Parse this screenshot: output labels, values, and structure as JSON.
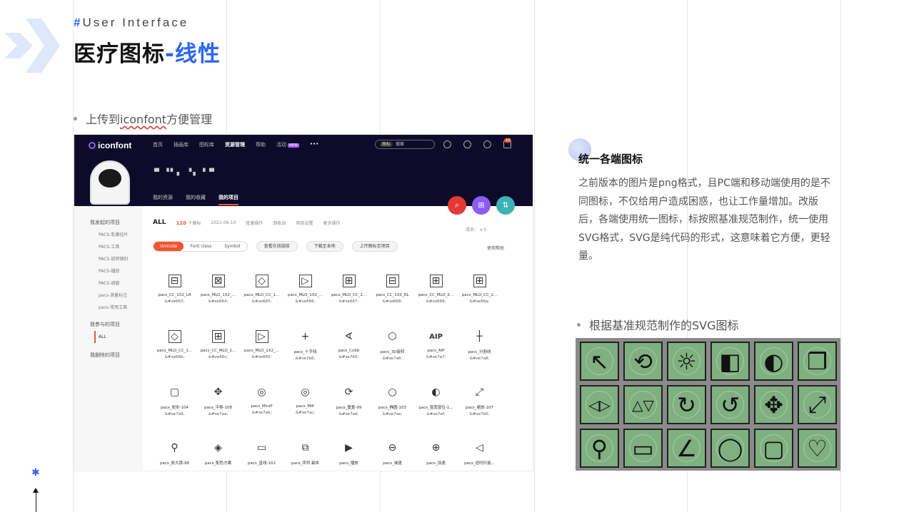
{
  "header": {
    "tag_hash": "#",
    "tag_text": "User Interface",
    "title_main": "医疗图标",
    "title_highlight": "-线性"
  },
  "bullets": {
    "upload_prefix": "上传到",
    "upload_link": "iconfont",
    "upload_suffix": "方便管理",
    "svg_standard": "根据基准规范制作的SVG图标"
  },
  "right": {
    "title": "统一各端图标",
    "paragraph": "之前版本的图片是png格式，且PC端和移动端使用的是不同图标，不仅给用户造成困惑，也让工作量增加。改版后，各端使用统一图标，标按照基准规范制作，统一使用SVG格式，SVG是纯代码的形式，这意味着它方便，更轻量。"
  },
  "screenshot": {
    "logo": "iconfont",
    "nav": [
      "首页",
      "插画库",
      "图标库",
      "资源管理",
      "帮助",
      "活动"
    ],
    "nav_new": "NEW",
    "nav_more": "•••",
    "search_select": "图标",
    "search_placeholder": "搜索",
    "badge": "15",
    "username": "▀ ▝▘▖ ▝▖ ▘▀",
    "subnav": [
      "我的资源",
      "我的收藏",
      "我的项目"
    ],
    "fab": [
      "⌕",
      "⊞",
      "⇅"
    ],
    "sidebar": {
      "started_title": "我发起的项目",
      "started_items": [
        "PACS-乳腺挂片",
        "PACS-工具",
        "PACS-放转镜封",
        "PACS-播放",
        "PACS-调窗",
        "pacs-测量标注",
        "pacs-常用工具"
      ],
      "joined_title": "我参与的项目",
      "joined_items": [
        "ALL"
      ],
      "deleted_title": "我删除的项目"
    },
    "all_label": "ALL",
    "count": "110",
    "count_unit": "个图标",
    "date": "2021-06-10",
    "actions": [
      "批量操作",
      "回收站",
      "项目设置",
      "更多操作"
    ],
    "members": "成员：",
    "members_count": "x 5",
    "tabs": [
      "Unicode",
      "Font class",
      "Symbol"
    ],
    "btn_online": "查看在线链接",
    "btn_download": "下载至本地",
    "btn_upload": "上传图标至项目",
    "help": "使用帮助",
    "icons": [
      {
        "g": "⊟",
        "b": true,
        "name": "pacs_CC_1X2_LR",
        "code": "&#xe663;"
      },
      {
        "g": "⊠",
        "b": true,
        "name": "pacs_MLO_1X2_...",
        "code": "&#xe664;"
      },
      {
        "g": "◇",
        "b": true,
        "name": "pacs_MLO_CC_1...",
        "code": "&#xe665;"
      },
      {
        "g": "▷",
        "b": true,
        "name": "pacs_MLO_1X2_...",
        "code": "&#xe666;"
      },
      {
        "g": "⊞",
        "b": true,
        "name": "pacs_MLO_CC_2...",
        "code": "&#xe667;"
      },
      {
        "g": "⊟",
        "b": true,
        "name": "pacs_CC_1X2_RL",
        "code": "&#xe668;"
      },
      {
        "g": "⊞",
        "b": true,
        "name": "pacs_CC_MLO_2...",
        "code": "&#xe669;"
      },
      {
        "g": "⊞",
        "b": true,
        "name": "pacs_MLO_CC_2...",
        "code": "&#xe66a;"
      },
      {
        "g": "◇",
        "b": true,
        "name": "pacs_MLO_CC_1...",
        "code": "&#xe66b;"
      },
      {
        "g": "⊞",
        "b": true,
        "name": "pacs_CC_MLO_2...",
        "code": "&#xe66c;"
      },
      {
        "g": "▷",
        "b": true,
        "name": "pacs_MLO_1X2_...",
        "code": "&#xe660;"
      },
      {
        "g": "+",
        "b": false,
        "name": "pacs_十字线",
        "code": "&#xe7b6;"
      },
      {
        "g": "∢",
        "b": false,
        "name": "pacs_Cobb",
        "code": "&#xe7b5;"
      },
      {
        "g": "⬡",
        "b": false,
        "name": "pacs_3D旋转",
        "code": "&#xe7a6;"
      },
      {
        "g": "AIP",
        "b": false,
        "name": "pacs_AIP",
        "code": "&#xe7a7;"
      },
      {
        "g": "┼",
        "b": false,
        "name": "pacs_分割线",
        "code": "&#xe7a8;"
      },
      {
        "g": "▢",
        "b": false,
        "name": "pacs_矩形-104",
        "code": "&#xe7a9;"
      },
      {
        "g": "✥",
        "b": false,
        "name": "pacs_平移-108",
        "code": "&#xe7aa;"
      },
      {
        "g": "◎",
        "b": false,
        "name": "pacs_MinIP",
        "code": "&#xe7ab;"
      },
      {
        "g": "◎",
        "b": false,
        "name": "pacs_MIP",
        "code": "&#xe7ac;"
      },
      {
        "g": "⟳",
        "b": false,
        "name": "pacs_重置-99",
        "code": "&#xe7ad;"
      },
      {
        "g": "○",
        "b": false,
        "name": "pacs_椭圆-103",
        "code": "&#xe7ae;"
      },
      {
        "g": "◐",
        "b": false,
        "name": "pacs_窗宽窗位-1...",
        "code": "&#xe7af;"
      },
      {
        "g": "⤢",
        "b": false,
        "name": "pacs_缩放-107",
        "code": "&#xe7b0;"
      },
      {
        "g": "⚲",
        "b": false,
        "name": "pacs_放大镜-98",
        "code": ""
      },
      {
        "g": "◈",
        "b": false,
        "name": "pacs_配色方案",
        "code": ""
      },
      {
        "g": "▭",
        "b": false,
        "name": "pacs_直线-102",
        "code": ""
      },
      {
        "g": "⧉",
        "b": false,
        "name": "pacs_序列 副本",
        "code": ""
      },
      {
        "g": "▶",
        "b": false,
        "name": "pacs_播放",
        "code": ""
      },
      {
        "g": "⊖",
        "b": false,
        "name": "pacs_减速",
        "code": ""
      },
      {
        "g": "⊕",
        "b": false,
        "name": "pacs_加速",
        "code": ""
      },
      {
        "g": "◁",
        "b": false,
        "name": "pacs_逆时针旋...",
        "code": ""
      }
    ]
  },
  "svg_tiles": [
    "cursor-icon",
    "rotate-icon",
    "contrast-sun-icon",
    "window-level-icon",
    "half-contrast-icon",
    "layers-icon",
    "flip-horizontal-icon",
    "flip-vertical-icon",
    "rotate-cw-icon",
    "rotate-ccw-icon",
    "move-icon",
    "expand-icon",
    "magnifier-icon",
    "ruler-icon",
    "angle-icon",
    "ellipse-icon",
    "rectangle-icon",
    "heart-roi-icon"
  ],
  "svg_tile_glyphs": [
    "↖",
    "⟲",
    "☼",
    "◧",
    "◐",
    "❐",
    "◁▷",
    "△▽",
    "↻",
    "↺",
    "✥",
    "⤢",
    "⚲",
    "▭",
    "∠",
    "◯",
    "▢",
    "♡"
  ],
  "colors": {
    "accent": "#2b67f6",
    "red": "#e53935",
    "purple": "#8b5cf6",
    "teal": "#3bb3b3",
    "topbar": "#0e0b2a"
  }
}
